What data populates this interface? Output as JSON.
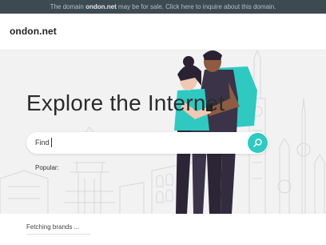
{
  "banner": {
    "prefix": "The domain",
    "domain": "ondon.net",
    "suffix": "may be for sale. Click here to inquire about this domain."
  },
  "header": {
    "logo": "ondon.net"
  },
  "hero": {
    "headline": "Explore the Internet",
    "search_label": "Find",
    "search_icon": "search-icon",
    "popular_label": "Popular:"
  },
  "footer": {
    "status": "Fetching brands ..."
  },
  "colors": {
    "accent": "#2fc9c2",
    "banner_bg": "#3d4a52",
    "hero_bg": "#f2f2f2"
  }
}
